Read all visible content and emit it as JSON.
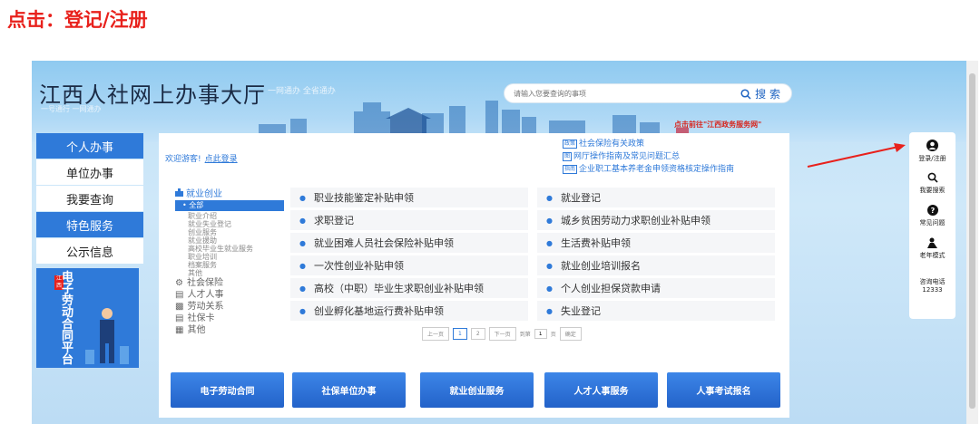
{
  "caption": "点击：登记/注册",
  "header": {
    "site_title": "江西人社网上办事大厅",
    "subtitle_right": "一网通办 全省通办",
    "subtitle_left": "一号通行 一网通办",
    "search_placeholder": "请输入您要查询的事项",
    "search_label": "搜 索",
    "gov_link": "点击前往\"江西政务服务网\""
  },
  "left_nav": [
    {
      "label": "个人办事",
      "style": "blue"
    },
    {
      "label": "单位办事",
      "style": "white"
    },
    {
      "label": "我要查询",
      "style": "white"
    },
    {
      "label": "特色服务",
      "style": "blue"
    },
    {
      "label": "公示信息",
      "style": "white"
    }
  ],
  "promo": {
    "tag": "江西",
    "title": "电子劳动合同平台"
  },
  "welcome": {
    "text": "欢迎游客!",
    "login": "点此登录"
  },
  "policy_links": [
    {
      "icon": "政策",
      "label": "社会保险有关政策"
    },
    {
      "icon": "图",
      "label": "网厅操作指南及常见问题汇总"
    },
    {
      "icon": "指南",
      "label": "企业职工基本养老金申领资格核定操作指南"
    }
  ],
  "categories": {
    "active_head": "就业创业",
    "all": "• 全部",
    "subs": [
      "职业介绍",
      "就业失业登记",
      "创业服务",
      "就业援助",
      "高校毕业生就业服务",
      "职业培训",
      "档案服务",
      "其他"
    ],
    "others": [
      "社会保险",
      "人才人事",
      "劳动关系",
      "社保卡",
      "其他"
    ]
  },
  "services": [
    "职业技能鉴定补贴申领",
    "就业登记",
    "求职登记",
    "城乡贫困劳动力求职创业补贴申领",
    "就业困难人员社会保险补贴申领",
    "生活费补贴申领",
    "一次性创业补贴申领",
    "就业创业培训报名",
    "高校（中职）毕业生求职创业补贴申领",
    "个人创业担保贷款申请",
    "创业孵化基地运行费补贴申领",
    "失业登记"
  ],
  "pager": {
    "prev": "上一页",
    "p1": "1",
    "p2": "2",
    "next": "下一页",
    "goto": "到第",
    "page_value": "1",
    "page_unit": "页",
    "confirm": "确定"
  },
  "features": [
    "电子劳动合同",
    "社保单位办事",
    "就业创业服务",
    "人才人事服务",
    "人事考试报名"
  ],
  "tools": {
    "login": "登录/注册",
    "search": "我要搜索",
    "faq": "常见问题",
    "elder": "老年模式",
    "hotline_label": "咨询电话",
    "hotline": "12333"
  },
  "colors": {
    "accent_blue": "#2f7ad9",
    "caption_red": "#e8211c",
    "arrow_red": "#e8211c"
  }
}
